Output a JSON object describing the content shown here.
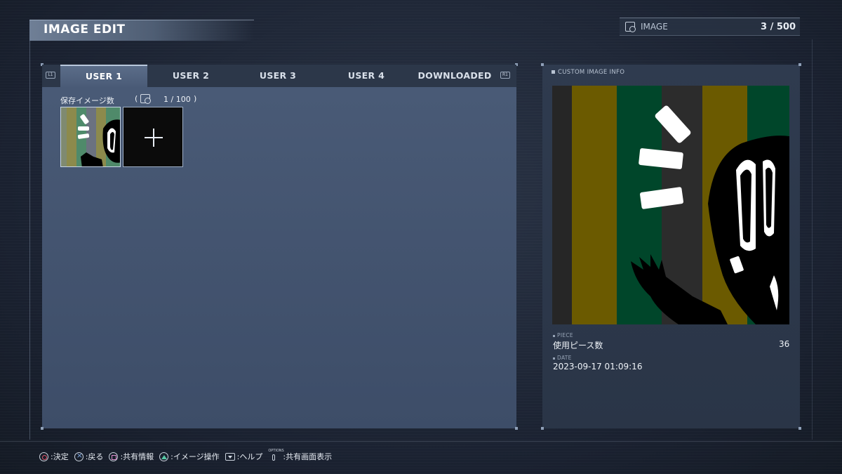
{
  "header": {
    "title": "IMAGE EDIT",
    "counter_label": "IMAGE",
    "counter_value": "3 / 500",
    "counter_icon": "image-stack-icon"
  },
  "tabs": {
    "left_hint": "L1",
    "right_hint": "R1",
    "items": [
      {
        "label": "USER 1",
        "active": true
      },
      {
        "label": "USER 2",
        "active": false
      },
      {
        "label": "USER 3",
        "active": false
      },
      {
        "label": "USER 4",
        "active": false
      },
      {
        "label": "DOWNLOADED",
        "active": false
      }
    ]
  },
  "storage": {
    "label": "保存イメージ数",
    "paren_open": "(",
    "count": "1 / 100",
    "paren_close": ")"
  },
  "grid": {
    "items": [
      {
        "type": "image"
      },
      {
        "type": "add-new",
        "icon": "plus-icon"
      }
    ]
  },
  "info": {
    "title": "CUSTOM IMAGE INFO",
    "piece_sub": "PIECE",
    "piece_label": "使用ピース数",
    "piece_value": "36",
    "date_sub": "DATE",
    "date_value": "2023-09-17 01:09:16"
  },
  "footer": {
    "items": [
      {
        "icon": "circle-button-icon",
        "label": ":決定"
      },
      {
        "icon": "cross-button-icon",
        "label": ":戻る"
      },
      {
        "icon": "square-button-icon",
        "label": ":共有情報"
      },
      {
        "icon": "triangle-button-icon",
        "label": ":イメージ操作"
      },
      {
        "icon": "dpad-down-icon",
        "label": ":ヘルプ"
      },
      {
        "icon": "options-button-icon",
        "label": ":共有画面表示",
        "icon_text": "OPTIONS"
      }
    ]
  },
  "colors": {
    "stripe_dark": "#262626",
    "stripe_olive": "#6b5a00",
    "stripe_green": "#00462a",
    "stripe_gray": "#3a3a3a"
  }
}
